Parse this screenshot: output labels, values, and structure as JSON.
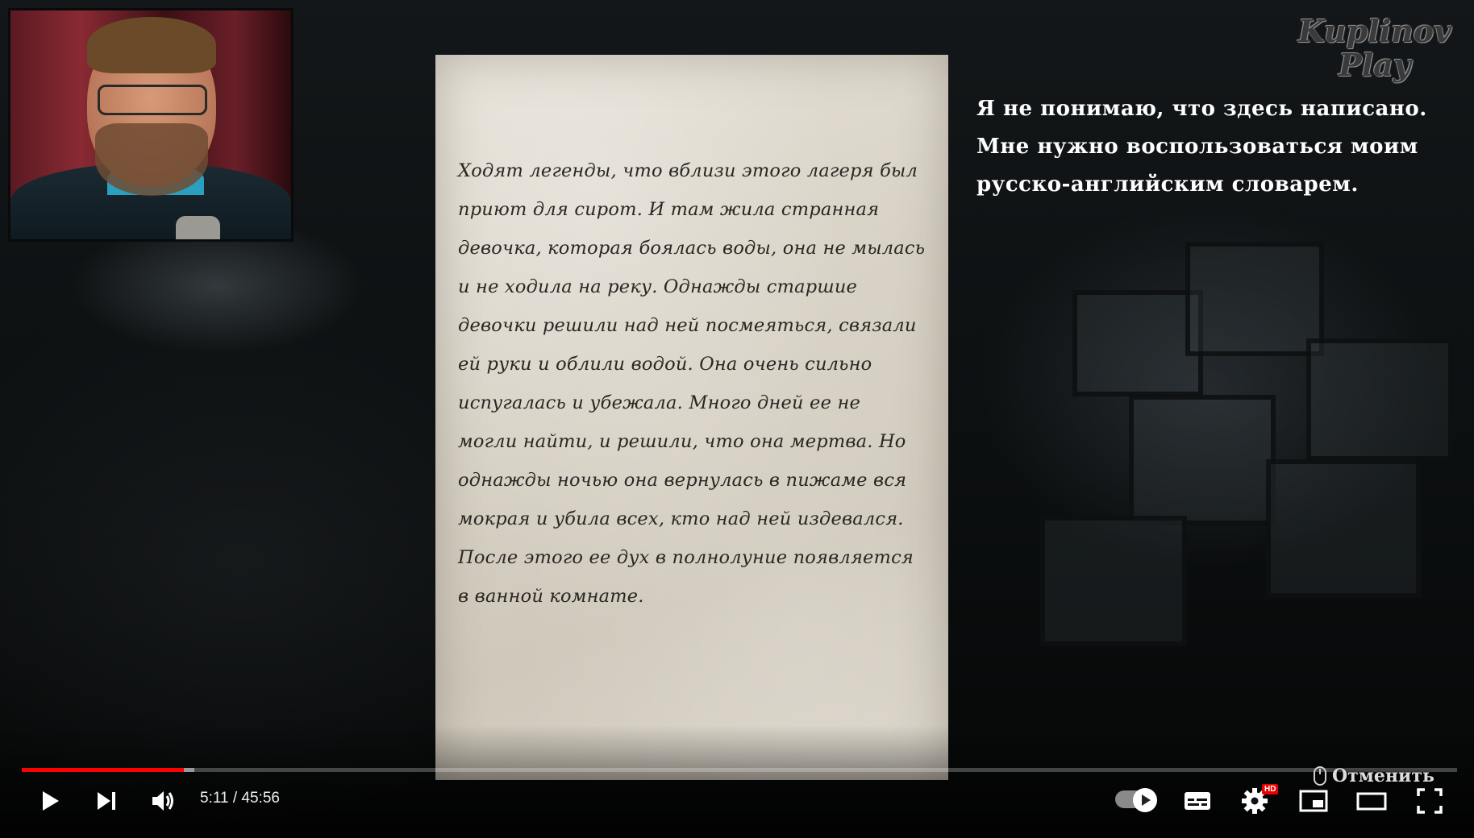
{
  "video": {
    "watermark": [
      "Kuplinov",
      "Play"
    ],
    "subtitle_lines": [
      "Я не понимаю, что здесь написано.",
      "Мне нужно воспользоваться моим",
      "русско-английским словарем."
    ],
    "letter_lines": [
      "Ходят легенды, что вблизи этого лагеря был",
      "  приют для сирот.  И там жила странная",
      "девочка, которая боялась воды, она не мылась",
      "  и не ходила на реку. Однажды старшие",
      "    девочки решили над ней посмеяться, связали",
      "ей руки и облили водой. Она очень сильно",
      "  испугалась и убежала. Много дней ее не",
      "могли найти, и решили, что она мертва. Но",
      "однажды ночью она вернулась в пижаме вся",
      "мокрая и убила всех, кто над ней издевался.",
      "  После этого ее дух в полнолуние появляется",
      "в ванной комнате."
    ]
  },
  "controls": {
    "current_time": "5:11",
    "duration": "45:56",
    "time_display": "5:11 / 45:56",
    "progress_played": 0.113,
    "progress_buffered": 0.12,
    "hd_badge": "HD",
    "cancel_label": "Отменить",
    "icons": {
      "play": "play-icon",
      "next": "next-icon",
      "volume": "volume-icon",
      "autoplay": "autoplay-toggle",
      "subtitles": "subtitles-icon",
      "settings": "gear-icon",
      "miniplayer": "miniplayer-icon",
      "theater": "theater-icon",
      "fullscreen": "fullscreen-icon"
    },
    "accent_color": "#ff0000"
  }
}
